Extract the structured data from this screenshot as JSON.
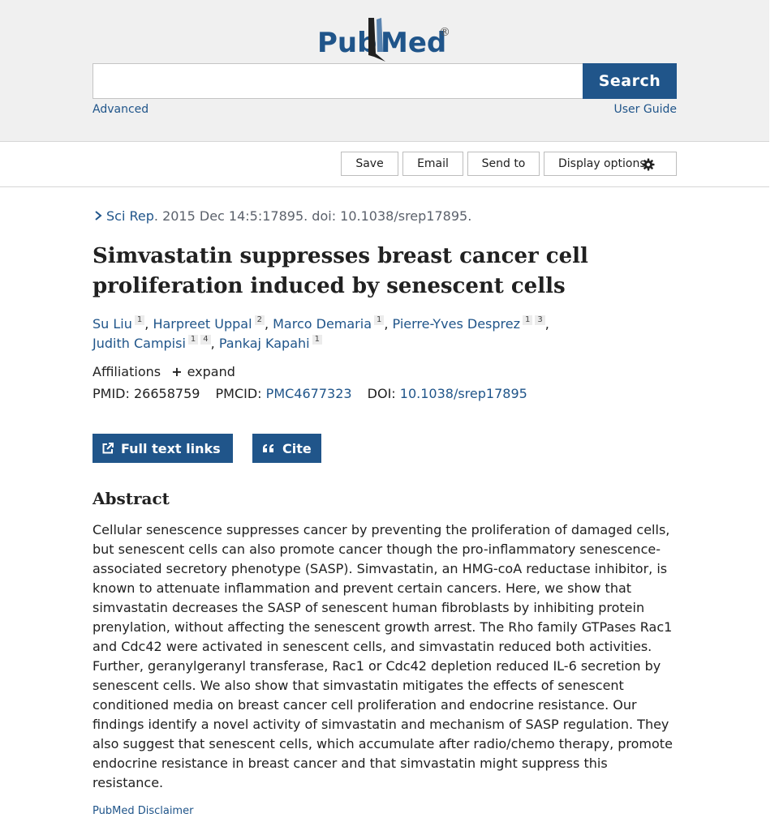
{
  "header": {
    "logo_text_left": "Pub",
    "logo_text_right": "Med",
    "logo_registered": "®",
    "search_value": "",
    "search_button": "Search",
    "advanced_link": "Advanced",
    "user_guide_link": "User Guide"
  },
  "actions": {
    "save": "Save",
    "email": "Email",
    "send_to": "Send to",
    "display_options": "Display options"
  },
  "citation": {
    "journal": "Sci Rep",
    "details": ". 2015 Dec 14:5:17895. doi: 10.1038/srep17895."
  },
  "article": {
    "title": "Simvastatin suppresses breast cancer cell proliferation induced by senescent cells",
    "authors": [
      {
        "name": "Su Liu",
        "affiliations": [
          "1"
        ],
        "sep": ", "
      },
      {
        "name": "Harpreet Uppal",
        "affiliations": [
          "2"
        ],
        "sep": ", "
      },
      {
        "name": "Marco Demaria",
        "affiliations": [
          "1"
        ],
        "sep": ", "
      },
      {
        "name": "Pierre-Yves Desprez",
        "affiliations": [
          "1",
          "3"
        ],
        "sep": ","
      },
      {
        "name": "Judith Campisi",
        "affiliations": [
          "1",
          "4"
        ],
        "sep": ", "
      },
      {
        "name": "Pankaj Kapahi",
        "affiliations": [
          "1"
        ],
        "sep": ""
      }
    ],
    "affiliations_label": "Affiliations",
    "expand_label": "expand",
    "pmid_label": "PMID:",
    "pmid": "26658759",
    "pmcid_label": "PMCID:",
    "pmcid": "PMC4677323",
    "doi_label": "DOI:",
    "doi": "10.1038/srep17895"
  },
  "buttons": {
    "full_text_links": "Full text links",
    "cite": "Cite"
  },
  "abstract": {
    "heading": "Abstract",
    "text": "Cellular senescence suppresses cancer by preventing the proliferation of damaged cells, but senescent cells can also promote cancer though the pro-inflammatory senescence-associated secretory phenotype (SASP). Simvastatin, an HMG-coA reductase inhibitor, is known to attenuate inflammation and prevent certain cancers. Here, we show that simvastatin decreases the SASP of senescent human fibroblasts by inhibiting protein prenylation, without affecting the senescent growth arrest. The Rho family GTPases Rac1 and Cdc42 were activated in senescent cells, and simvastatin reduced both activities. Further, geranylgeranyl transferase, Rac1 or Cdc42 depletion reduced IL-6 secretion by senescent cells. We also show that simvastatin mitigates the effects of senescent conditioned media on breast cancer cell proliferation and endocrine resistance. Our findings identify a novel activity of simvastatin and mechanism of SASP regulation. They also suggest that senescent cells, which accumulate after radio/chemo therapy, promote endocrine resistance in breast cancer and that simvastatin might suppress this resistance."
  },
  "footer": {
    "disclaimer": "PubMed Disclaimer"
  },
  "colors": {
    "link": "#20558a",
    "header_bg": "#f0f0f0",
    "logo_pub": "#20558a",
    "logo_bookmark": "#212121"
  },
  "icons": {
    "chevron": "chevron-right-icon",
    "gear": "gear-icon",
    "external_link": "external-link-icon",
    "quote": "quote-icon",
    "plus": "plus-icon"
  }
}
